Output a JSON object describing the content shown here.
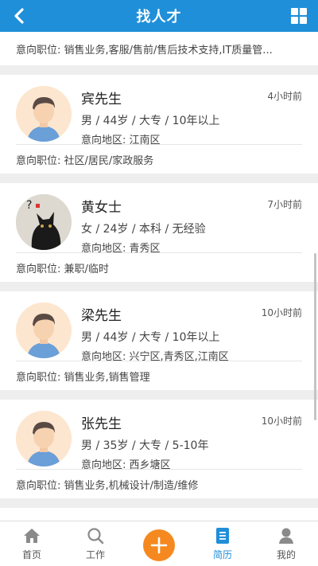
{
  "header": {
    "title": "找人才"
  },
  "partial_row": {
    "text": "意向职位: 销售业务,客服/售前/售后技术支持,IT质量管..."
  },
  "candidates": [
    {
      "name": "宾先生",
      "time": "4小时前",
      "meta": "男 / 44岁 / 大专 / 10年以上",
      "area": "意向地区: 江南区",
      "position": "意向职位: 社区/居民/家政服务",
      "avatar": "male-avatar"
    },
    {
      "name": "黄女士",
      "time": "7小时前",
      "meta": "女 / 24岁 / 本科 / 无经验",
      "area": "意向地区: 青秀区",
      "position": "意向职位: 兼职/临时",
      "avatar": "cat-photo"
    },
    {
      "name": "梁先生",
      "time": "10小时前",
      "meta": "男 / 44岁 / 大专 / 10年以上",
      "area": "意向地区: 兴宁区,青秀区,江南区",
      "position": "意向职位: 销售业务,销售管理",
      "avatar": "male-avatar"
    },
    {
      "name": "张先生",
      "time": "10小时前",
      "meta": "男 / 35岁 / 大专 / 5-10年",
      "area": "意向地区: 西乡塘区",
      "position": "意向职位: 销售业务,机械设计/制造/维修",
      "avatar": "male-avatar"
    }
  ],
  "tabbar": {
    "home": "首页",
    "jobs": "工作",
    "resume": "简历",
    "me": "我的"
  },
  "colors": {
    "primary": "#1f8fd9",
    "accent": "#f5891f"
  }
}
